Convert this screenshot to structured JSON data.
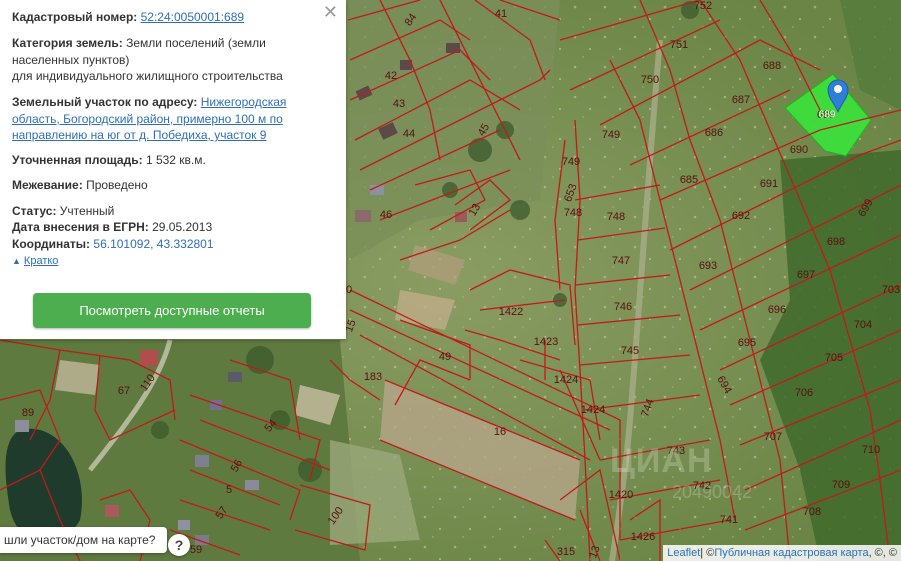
{
  "panel": {
    "cadastral_label": "Кадастровый номер:",
    "cadastral_value": "52:24:0050001:689",
    "category_label": "Категория земель:",
    "category_value_line1": "Земли поселений (земли",
    "category_value_line2": "населенных пунктов)",
    "category_value_line3": "для индивидуального жилищного строительства",
    "address_label": "Земельный участок по адресу:",
    "address_line1": "Нижегородская",
    "address_line2": "область, Богородский район, примерно 100 м по",
    "address_line3": "направлению на юг от д. Победиха, участок 9",
    "area_label": "Уточненная площадь:",
    "area_value": "1 532 кв.м.",
    "survey_label": "Межевание:",
    "survey_value": "Проведено",
    "status_label": "Статус:",
    "status_value": "Учтенный",
    "date_label": "Дата внесения в ЕГРН:",
    "date_value": "29.05.2013",
    "coords_label": "Координаты:",
    "coords_value": "56.101092, 43.332801",
    "collapse_label": "Кратко",
    "reports_button": "Посмотреть доступные отчеты",
    "close_icon": "close-icon"
  },
  "search_prompt": {
    "text": "шли участок/дом на карте?",
    "help": "?"
  },
  "attribution": {
    "leaflet": "Leaflet",
    "separator": " | © ",
    "source": "Публичная кадастровая карта",
    "suffix": ", ©, ©"
  },
  "watermark": {
    "brand": "ЦИАН",
    "id": "20490042"
  },
  "plots": [
    "752",
    "41",
    "84",
    "751",
    "688",
    "750",
    "687",
    "42",
    "43",
    "749",
    "686",
    "689",
    "690",
    "44",
    "45",
    "749",
    "685",
    "691",
    "653",
    "748",
    "13",
    "748",
    "692",
    "46",
    "699",
    "693",
    "747",
    "698",
    "697",
    "1422",
    "746",
    "696",
    "703",
    "704",
    "1423",
    "745",
    "695",
    "705",
    "49",
    "183",
    "1424",
    "694",
    "706",
    "744",
    "67",
    "110",
    "89",
    "1424",
    "54",
    "16",
    "707",
    "743",
    "710",
    "56",
    "1420",
    "742",
    "709",
    "5",
    "741",
    "708",
    "100",
    "57",
    "1426",
    "59",
    "315",
    "13",
    "15",
    "0"
  ],
  "selected_plot": {
    "number": "689",
    "color": "#3de03d"
  },
  "colors": {
    "boundary": "#c21a1a",
    "accent": "#2e6fb7",
    "button": "#4cae4f",
    "marker": "#2f7fd9"
  },
  "icons": {
    "marker": "map-marker-icon",
    "arrow": "arrow-up-icon"
  }
}
